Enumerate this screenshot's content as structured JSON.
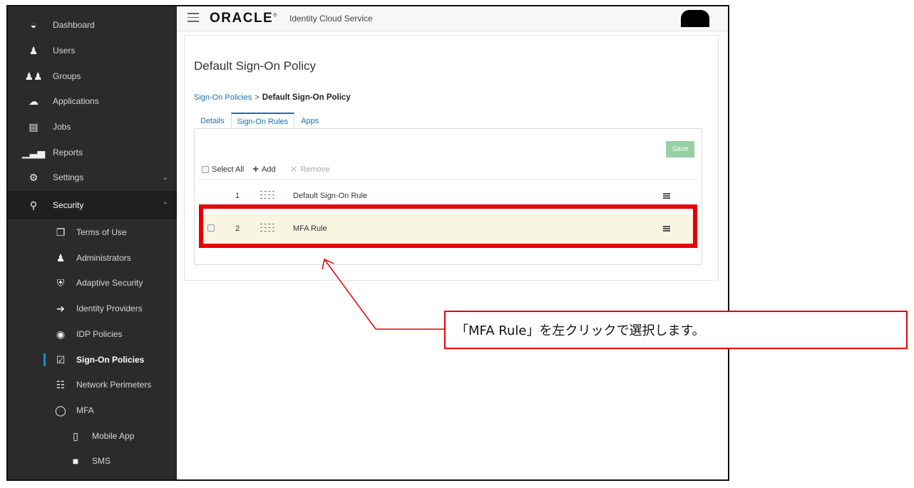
{
  "sidebar": {
    "items": [
      {
        "label": "Dashboard",
        "icon": "dashboard-icon"
      },
      {
        "label": "Users",
        "icon": "user-icon"
      },
      {
        "label": "Groups",
        "icon": "group-icon"
      },
      {
        "label": "Applications",
        "icon": "cloud-icon"
      },
      {
        "label": "Jobs",
        "icon": "jobs-icon"
      },
      {
        "label": "Reports",
        "icon": "bar-chart-icon"
      },
      {
        "label": "Settings",
        "icon": "gear-icon"
      },
      {
        "label": "Security",
        "icon": "key-icon"
      },
      {
        "label": "Terms of Use",
        "icon": "documents-icon"
      },
      {
        "label": "Administrators",
        "icon": "admin-icon"
      },
      {
        "label": "Adaptive Security",
        "icon": "shield-icon"
      },
      {
        "label": "Identity Providers",
        "icon": "sign-in-icon"
      },
      {
        "label": "IDP Policies",
        "icon": "policy-icon"
      },
      {
        "label": "Sign-On Policies",
        "icon": "checklist-icon"
      },
      {
        "label": "Network Perimeters",
        "icon": "network-icon"
      },
      {
        "label": "MFA",
        "icon": "lock-icon"
      },
      {
        "label": "Mobile App",
        "icon": "mobile-icon"
      },
      {
        "label": "SMS",
        "icon": "message-icon"
      }
    ]
  },
  "header": {
    "logo": "ORACLE",
    "registered": "®",
    "service": "Identity Cloud Service"
  },
  "main": {
    "title": "Default Sign-On Policy",
    "breadcrumb": {
      "parent": "Sign-On Policies",
      "separator": ">",
      "current": "Default Sign-On Policy"
    },
    "tabs": [
      {
        "label": "Details"
      },
      {
        "label": "Sign-On Rules"
      },
      {
        "label": "Apps"
      }
    ],
    "save_label": "Save",
    "toolbar": {
      "select_all": "Select All",
      "add": "Add",
      "remove": "Remove"
    },
    "rules": [
      {
        "num": "1",
        "name": "Default Sign-On Rule"
      },
      {
        "num": "2",
        "name": "MFA Rule"
      }
    ]
  },
  "annotation": {
    "callout": "「MFA Rule」を左クリックで選択します。",
    "color": "#e60000"
  },
  "colors": {
    "sidebar": "#2b2b2b",
    "link": "#1a6fb4",
    "save": "#97d0a2",
    "selected_row": "#f8f5e1"
  }
}
